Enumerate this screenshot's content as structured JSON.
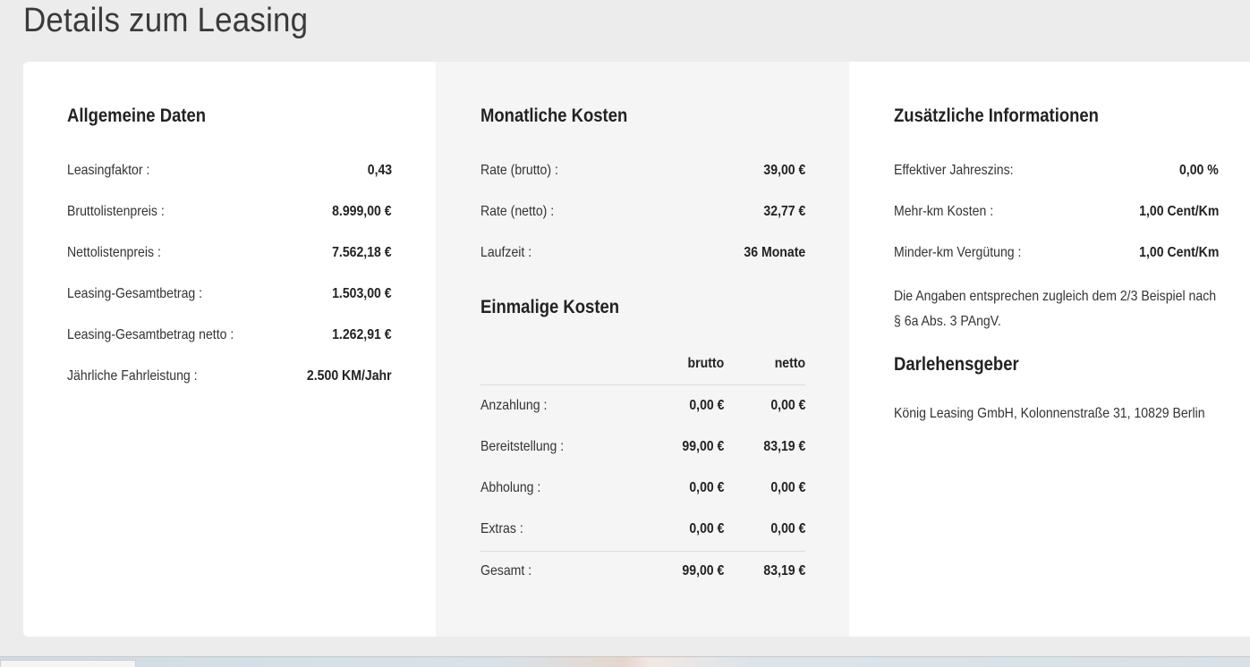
{
  "page": {
    "title": "Details zum Leasing"
  },
  "general": {
    "heading": "Allgemeine Daten",
    "rows": [
      {
        "label": "Leasingfaktor :",
        "value": "0,43"
      },
      {
        "label": "Bruttolistenpreis :",
        "value": "8.999,00 €"
      },
      {
        "label": "Nettolistenpreis :",
        "value": "7.562,18 €"
      },
      {
        "label": "Leasing-Gesamtbetrag :",
        "value": "1.503,00 €"
      },
      {
        "label": "Leasing-Gesamtbetrag netto :",
        "value": "1.262,91 €"
      },
      {
        "label": "Jährliche Fahrleistung :",
        "value": "2.500 KM/Jahr"
      }
    ]
  },
  "monthly": {
    "heading": "Monatliche Kosten",
    "rows": [
      {
        "label": "Rate (brutto) :",
        "value": "39,00 €"
      },
      {
        "label": "Rate (netto) :",
        "value": "32,77 €"
      },
      {
        "label": "Laufzeit :",
        "value": "36 Monate"
      }
    ]
  },
  "onetime": {
    "heading": "Einmalige Kosten",
    "columns": {
      "gross": "brutto",
      "net": "netto"
    },
    "rows": [
      {
        "label": "Anzahlung :",
        "gross": "0,00 €",
        "net": "0,00 €"
      },
      {
        "label": "Bereitstellung :",
        "gross": "99,00 €",
        "net": "83,19 €"
      },
      {
        "label": "Abholung :",
        "gross": "0,00 €",
        "net": "0,00 €"
      },
      {
        "label": "Extras :",
        "gross": "0,00 €",
        "net": "0,00 €"
      }
    ],
    "total": {
      "label": "Gesamt :",
      "gross": "99,00 €",
      "net": "83,19 €"
    }
  },
  "additional": {
    "heading": "Zusätzliche Informationen",
    "rows": [
      {
        "label": "Effektiver Jahreszins:",
        "value": "0,00 %"
      },
      {
        "label": "Mehr-km Kosten :",
        "value": "1,00 Cent/Km"
      },
      {
        "label": "Minder-km Vergütung :",
        "value": "1,00 Cent/Km"
      }
    ],
    "note": "Die Angaben entsprechen zugleich dem 2/3 Beispiel nach § 6a Abs. 3 PAngV."
  },
  "lender": {
    "heading": "Darlehensgeber",
    "address": "König Leasing GmbH, Kolonnenstraße 31, 10829 Berlin"
  }
}
